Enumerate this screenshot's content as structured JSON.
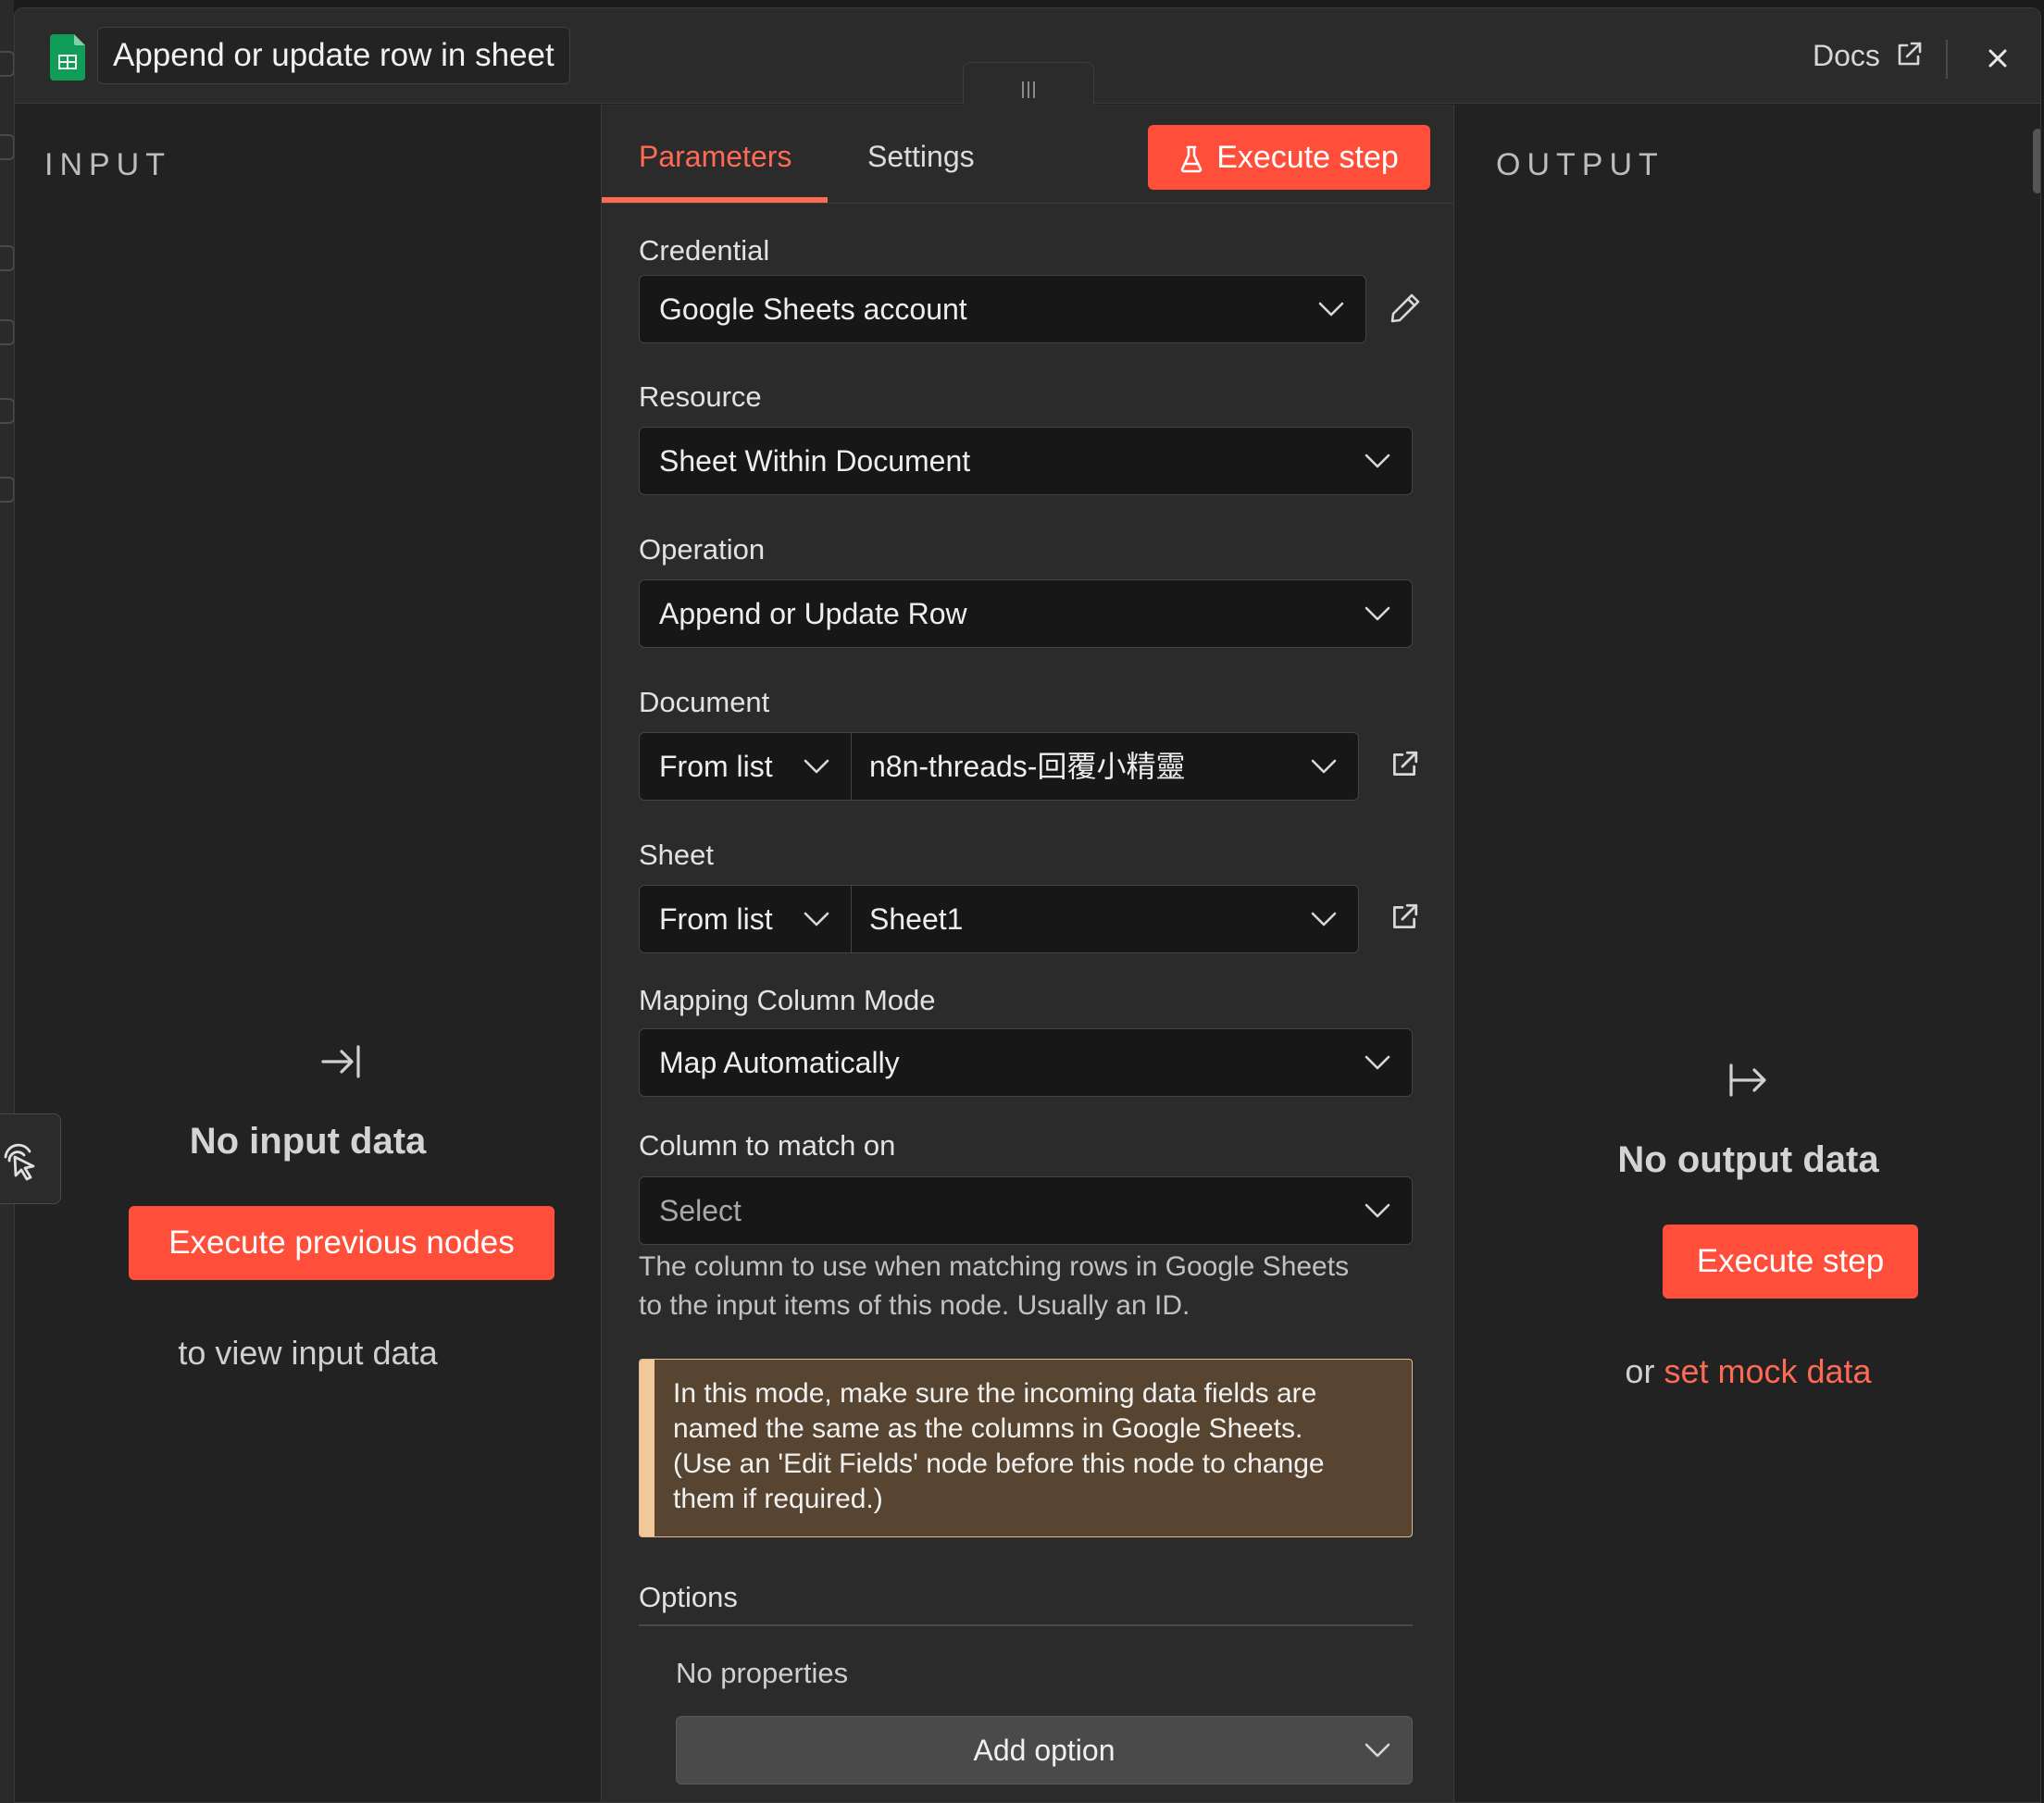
{
  "header": {
    "node_title": "Append or update row in sheet",
    "docs_label": "Docs"
  },
  "input_panel": {
    "heading": "INPUT",
    "empty_title": "No input data",
    "execute_button": "Execute previous nodes",
    "hint": "to view input data"
  },
  "parameters_panel": {
    "tabs": [
      {
        "label": "Parameters",
        "active": true
      },
      {
        "label": "Settings",
        "active": false
      }
    ],
    "execute_button": "Execute step",
    "fields": {
      "credential": {
        "label": "Credential",
        "value": "Google Sheets account"
      },
      "resource": {
        "label": "Resource",
        "value": "Sheet Within Document"
      },
      "operation": {
        "label": "Operation",
        "value": "Append or Update Row"
      },
      "document": {
        "label": "Document",
        "mode": "From list",
        "value": "n8n-threads-回覆小精靈"
      },
      "sheet": {
        "label": "Sheet",
        "mode": "From list",
        "value": "Sheet1"
      },
      "mapping_mode": {
        "label": "Mapping Column Mode",
        "value": "Map Automatically"
      },
      "match_column": {
        "label": "Column to match on",
        "placeholder": "Select",
        "help_line1": "The column to use when matching rows in Google Sheets",
        "help_line2": "to the input items of this node. Usually an ID."
      }
    },
    "notice": {
      "line1": "In this mode, make sure the incoming data fields are",
      "line2": "named the same as the columns in Google Sheets.",
      "line3": "(Use an 'Edit Fields' node before this node to change",
      "line4": "them if required.)"
    },
    "options": {
      "label": "Options",
      "empty_text": "No properties",
      "add_button": "Add option"
    }
  },
  "output_panel": {
    "heading": "OUTPUT",
    "empty_title": "No output data",
    "execute_button": "Execute step",
    "or_text": "or",
    "mock_link": "set mock data"
  },
  "colors": {
    "accent": "#ff4f3a",
    "accent_text": "#ff6a55",
    "notice_bg": "#574531",
    "notice_border": "#f3c899",
    "sheets_green": "#0f9d58"
  },
  "icons": {
    "node": "google-sheets-icon",
    "docs": "external-link-icon",
    "close": "close-icon",
    "execute": "flask-icon",
    "edit_credential": "pencil-icon",
    "open_document": "external-link-icon",
    "input_empty": "arrow-to-right-bar-icon",
    "output_empty": "arrow-from-bar-right-icon",
    "side_button": "pointer-click-icon"
  }
}
